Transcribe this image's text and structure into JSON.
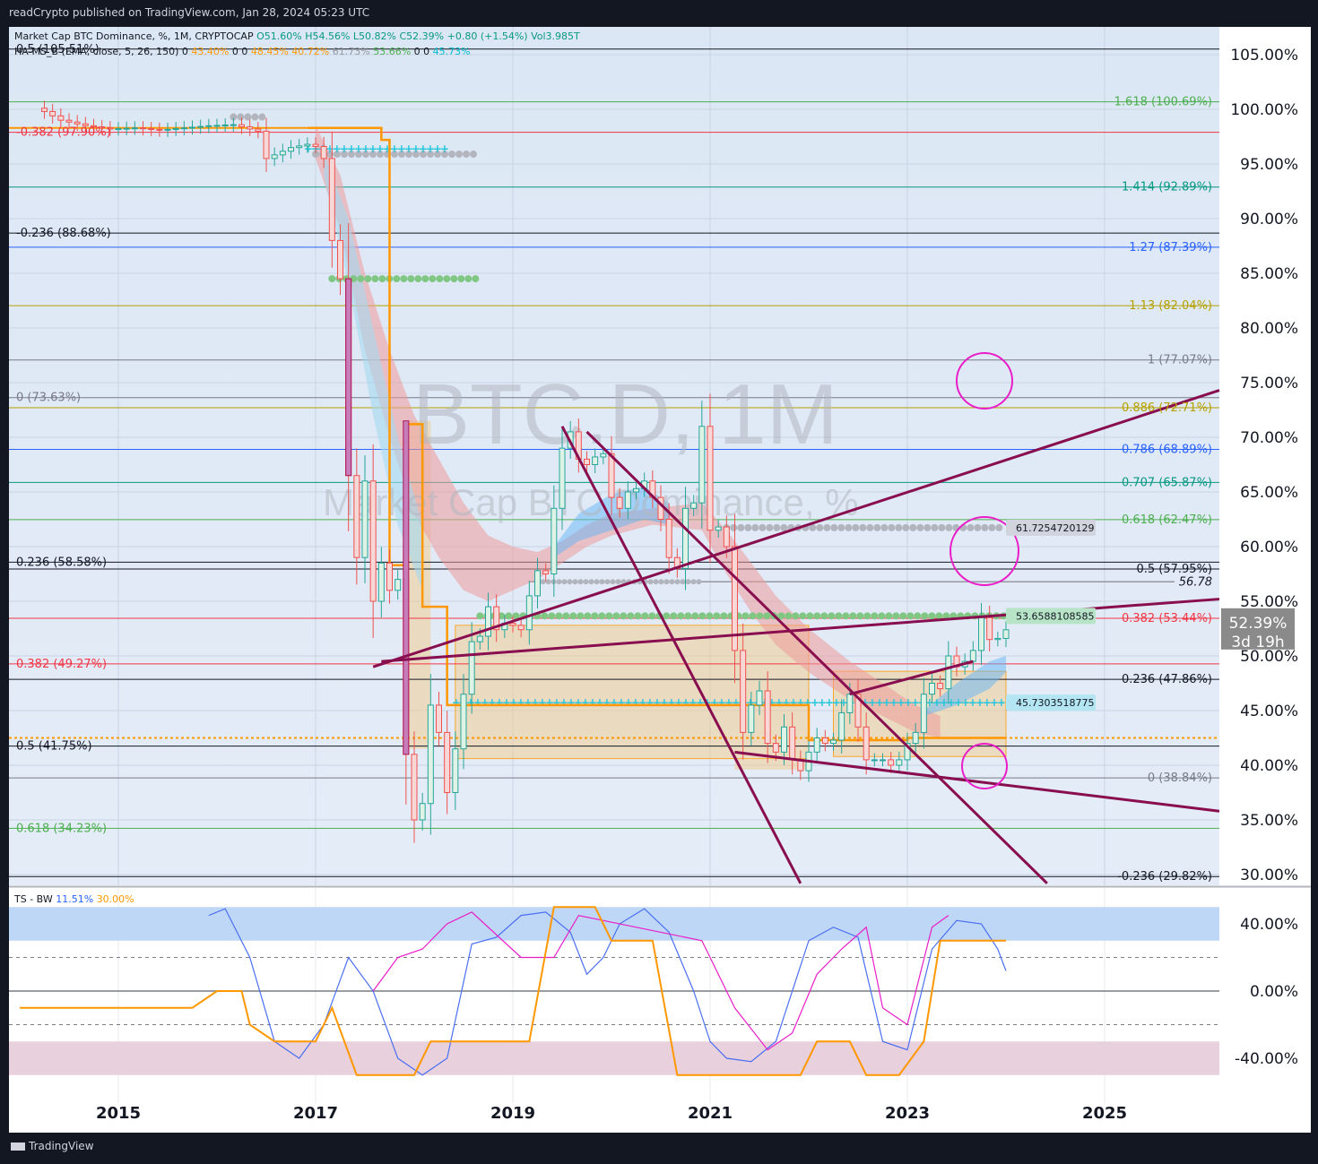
{
  "header": {
    "published": "readCrypto published on TradingView.com, Jan 28, 2024 05:23 UTC"
  },
  "footer": {
    "brand": "TradingView"
  },
  "legend": {
    "symbol": "Market Cap BTC Dominance, %, 1M, CRYPTOCAP",
    "o": "O51.60%",
    "h": "H54.56%",
    "l": "L50.82%",
    "c": "C52.39%",
    "chg": "+0.80 (+1.54%)",
    "vol": "Vol3.985T",
    "indicator": "HA-MS_B (EMA, close, 5, 26, 150)",
    "ind_vals": [
      "0",
      "43.40%",
      "0",
      "0",
      "48.45%",
      "40.72%",
      "61.73%",
      "53.66%",
      "0",
      "0",
      "45.73%"
    ]
  },
  "watermark": {
    "line1": "BTC.D, 1M",
    "line2": "Market Cap BTC Dominance, %"
  },
  "price_axis": [
    "105.00%",
    "100.00%",
    "95.00%",
    "90.00%",
    "85.00%",
    "80.00%",
    "75.00%",
    "70.00%",
    "65.00%",
    "60.00%",
    "55.00%",
    "50.00%",
    "45.00%",
    "40.00%",
    "35.00%",
    "30.00%"
  ],
  "last_price": {
    "value": "52.39%",
    "countdown": "3d 19h"
  },
  "time_axis": [
    "2015",
    "2017",
    "2019",
    "2021",
    "2023",
    "2025"
  ],
  "fib_left": [
    {
      "label": "0.5 (105.51%)",
      "color": "#131722"
    },
    {
      "label": "-0.382 (97.90%)",
      "color": "#f23645"
    },
    {
      "label": "-0.236 (88.68%)",
      "color": "#131722"
    },
    {
      "label": "0 (73.63%)",
      "color": "#787b86"
    },
    {
      "label": "0.236 (58.58%)",
      "color": "#131722"
    },
    {
      "label": "0.382 (49.27%)",
      "color": "#f23645"
    },
    {
      "label": "0.5 (41.75%)",
      "color": "#131722"
    },
    {
      "label": "0.618 (34.23%)",
      "color": "#4caf50"
    }
  ],
  "fib_right": [
    {
      "label": "1.618 (100.69%)",
      "color": "#4caf50"
    },
    {
      "label": "1.414 (92.89%)",
      "color": "#089981"
    },
    {
      "label": "1.27 (87.39%)",
      "color": "#2962ff"
    },
    {
      "label": "1.13 (82.04%)",
      "color": "#b5a000"
    },
    {
      "label": "1 (77.07%)",
      "color": "#787b86"
    },
    {
      "label": "0.886 (72.71%)",
      "color": "#b5a000"
    },
    {
      "label": "0.786 (68.89%)",
      "color": "#2962ff"
    },
    {
      "label": "0.707 (65.87%)",
      "color": "#089981"
    },
    {
      "label": "0.618 (62.47%)",
      "color": "#4caf50"
    },
    {
      "label": "0.5 (57.95%)",
      "color": "#131722"
    },
    {
      "label": "0.382 (53.44%)",
      "color": "#f23645"
    },
    {
      "label": "0.236 (47.86%)",
      "color": "#131722"
    },
    {
      "label": "0 (38.84%)",
      "color": "#787b86"
    },
    {
      "label": "-0.236 (29.82%)",
      "color": "#131722"
    }
  ],
  "level_tags": [
    {
      "label": "61.7254720129",
      "color": "#d1d4dc"
    },
    {
      "label": "56.78",
      "color": "#ffffff"
    },
    {
      "label": "53.6588108585",
      "color": "#b7e4c7"
    },
    {
      "label": "45.7303518775",
      "color": "#b3e5f2"
    }
  ],
  "oscillator": {
    "title": "TS - BW",
    "val1": "11.51%",
    "val2": "30.00%",
    "axis": [
      "40.00%",
      "0.00%",
      "-40.00%"
    ]
  },
  "colors": {
    "up": "#26a69a",
    "down": "#ef5350",
    "trendline": "#880e4f",
    "circle": "#e91ec8",
    "orange": "#ff9800"
  },
  "chart_data": {
    "type": "candlestick",
    "title": "BTC.D, 1M",
    "ylim": [
      28,
      107
    ],
    "xlim": [
      "2014-01",
      "2026-09"
    ],
    "monthly_close": [
      [
        "2014-04",
        99.8
      ],
      [
        "2014-06",
        99.0
      ],
      [
        "2014-09",
        98.5
      ],
      [
        "2014-12",
        98.2
      ],
      [
        "2015-03",
        98.3
      ],
      [
        "2015-06",
        98.1
      ],
      [
        "2015-09",
        98.3
      ],
      [
        "2015-12",
        98.5
      ],
      [
        "2016-03",
        98.6
      ],
      [
        "2016-06",
        98.0
      ],
      [
        "2016-07",
        95.5
      ],
      [
        "2016-10",
        96.5
      ],
      [
        "2016-12",
        96.8
      ],
      [
        "2017-01",
        96.6
      ],
      [
        "2017-02",
        95.5
      ],
      [
        "2017-03",
        88.0
      ],
      [
        "2017-04",
        84.5
      ],
      [
        "2017-05",
        66.5
      ],
      [
        "2017-06",
        59.0
      ],
      [
        "2017-07",
        66.0
      ],
      [
        "2017-08",
        55.0
      ],
      [
        "2017-09",
        58.5
      ],
      [
        "2017-10",
        56.0
      ],
      [
        "2017-11",
        57.0
      ],
      [
        "2017-12",
        41.0
      ],
      [
        "2018-01",
        35.0
      ],
      [
        "2018-02",
        36.5
      ],
      [
        "2018-03",
        45.5
      ],
      [
        "2018-04",
        43.0
      ],
      [
        "2018-05",
        37.5
      ],
      [
        "2018-06",
        41.5
      ],
      [
        "2018-07",
        46.5
      ],
      [
        "2018-08",
        51.3
      ],
      [
        "2018-09",
        51.8
      ],
      [
        "2018-10",
        54.5
      ],
      [
        "2018-11",
        52.4
      ],
      [
        "2018-12",
        53.0
      ],
      [
        "2019-01",
        52.8
      ],
      [
        "2019-02",
        52.4
      ],
      [
        "2019-03",
        55.5
      ],
      [
        "2019-04",
        57.8
      ],
      [
        "2019-05",
        57.5
      ],
      [
        "2019-06",
        63.5
      ],
      [
        "2019-07",
        69.0
      ],
      [
        "2019-08",
        70.5
      ],
      [
        "2019-09",
        68.0
      ],
      [
        "2019-10",
        67.5
      ],
      [
        "2019-11",
        68.2
      ],
      [
        "2019-12",
        68.5
      ],
      [
        "2020-01",
        64.5
      ],
      [
        "2020-02",
        63.5
      ],
      [
        "2020-03",
        65.0
      ],
      [
        "2020-04",
        65.3
      ],
      [
        "2020-05",
        66.0
      ],
      [
        "2020-06",
        64.5
      ],
      [
        "2020-07",
        62.5
      ],
      [
        "2020-08",
        59.0
      ],
      [
        "2020-09",
        58.0
      ],
      [
        "2020-10",
        63.5
      ],
      [
        "2020-11",
        64.0
      ],
      [
        "2020-12",
        71.0
      ],
      [
        "2021-01",
        61.5
      ],
      [
        "2021-02",
        61.8
      ],
      [
        "2021-03",
        60.0
      ],
      [
        "2021-04",
        50.5
      ],
      [
        "2021-05",
        43.0
      ],
      [
        "2021-06",
        45.5
      ],
      [
        "2021-07",
        46.8
      ],
      [
        "2021-08",
        42.0
      ],
      [
        "2021-09",
        41.2
      ],
      [
        "2021-10",
        43.5
      ],
      [
        "2021-11",
        40.5
      ],
      [
        "2021-12",
        39.5
      ],
      [
        "2022-01",
        41.2
      ],
      [
        "2022-02",
        42.5
      ],
      [
        "2022-03",
        42.0
      ],
      [
        "2022-04",
        42.3
      ],
      [
        "2022-05",
        44.8
      ],
      [
        "2022-06",
        46.5
      ],
      [
        "2022-07",
        43.5
      ],
      [
        "2022-08",
        40.5
      ],
      [
        "2022-09",
        40.5
      ],
      [
        "2022-10",
        40.5
      ],
      [
        "2022-11",
        40.0
      ],
      [
        "2022-12",
        40.5
      ],
      [
        "2023-01",
        42.0
      ],
      [
        "2023-02",
        43.0
      ],
      [
        "2023-03",
        46.5
      ],
      [
        "2023-04",
        47.5
      ],
      [
        "2023-05",
        47.0
      ],
      [
        "2023-06",
        50.0
      ],
      [
        "2023-07",
        49.0
      ],
      [
        "2023-08",
        49.5
      ],
      [
        "2023-09",
        50.5
      ],
      [
        "2023-10",
        53.5
      ],
      [
        "2023-11",
        51.5
      ],
      [
        "2023-12",
        51.6
      ],
      [
        "2024-01",
        52.39
      ]
    ]
  }
}
